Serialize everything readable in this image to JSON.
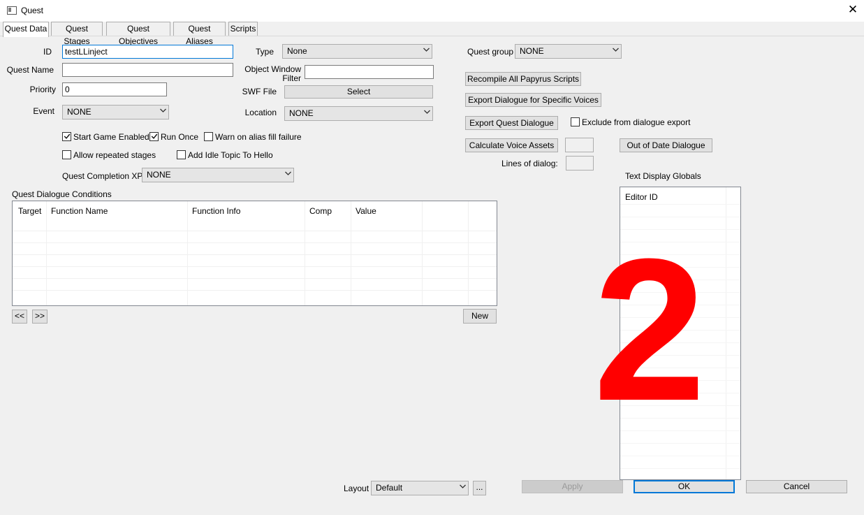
{
  "window": {
    "title": "Quest",
    "close_glyph": "✕"
  },
  "tabs": [
    {
      "label": "Quest Data",
      "active": true
    },
    {
      "label": "Quest Stages"
    },
    {
      "label": "Quest Objectives"
    },
    {
      "label": "Quest Aliases"
    },
    {
      "label": "Scripts"
    }
  ],
  "form": {
    "id_label": "ID",
    "id_value": "testLLinject",
    "quest_name_label": "Quest Name",
    "quest_name_value": "",
    "priority_label": "Priority",
    "priority_value": "0",
    "event_label": "Event",
    "event_value": "NONE",
    "type_label": "Type",
    "type_value": "None",
    "object_window_filter_label_1": "Object Window",
    "object_window_filter_label_2": "Filter",
    "object_window_filter_value": "",
    "swf_file_label": "SWF File",
    "swf_select_label": "Select",
    "location_label": "Location",
    "location_value": "NONE",
    "quest_group_label": "Quest group",
    "quest_group_value": "NONE",
    "quest_completion_xp_label": "Quest Completion XP",
    "quest_completion_xp_value": "NONE"
  },
  "checkboxes": {
    "start_game_enabled": {
      "label": "Start Game Enabled",
      "checked": true
    },
    "run_once": {
      "label": "Run Once",
      "checked": true
    },
    "warn_alias": {
      "label": "Warn on alias fill failure",
      "checked": false
    },
    "allow_repeated": {
      "label": "Allow repeated stages",
      "checked": false
    },
    "add_idle_topic": {
      "label": "Add Idle Topic To Hello",
      "checked": false
    },
    "exclude_dialogue": {
      "label": "Exclude from dialogue export",
      "checked": false
    }
  },
  "actions": {
    "recompile": "Recompile All Papyrus Scripts",
    "export_specific": "Export Dialogue for Specific Voices",
    "export_quest": "Export Quest Dialogue",
    "calc_voice": "Calculate Voice Assets",
    "out_of_date": "Out of Date Dialogue",
    "lines_of_dialog_label": "Lines of dialog:"
  },
  "conditions": {
    "label": "Quest Dialogue Conditions",
    "columns": [
      "Target",
      "Function Name",
      "Function Info",
      "Comp",
      "Value"
    ],
    "prev": "<<",
    "next": ">>",
    "new_label": "New"
  },
  "globals": {
    "label": "Text Display Globals",
    "column": "Editor ID"
  },
  "overlay": {
    "number": "2",
    "color": "#ff0000"
  },
  "footer": {
    "layout_label": "Layout",
    "layout_value": "Default",
    "ellipsis": "...",
    "apply": "Apply",
    "ok": "OK",
    "cancel": "Cancel"
  }
}
